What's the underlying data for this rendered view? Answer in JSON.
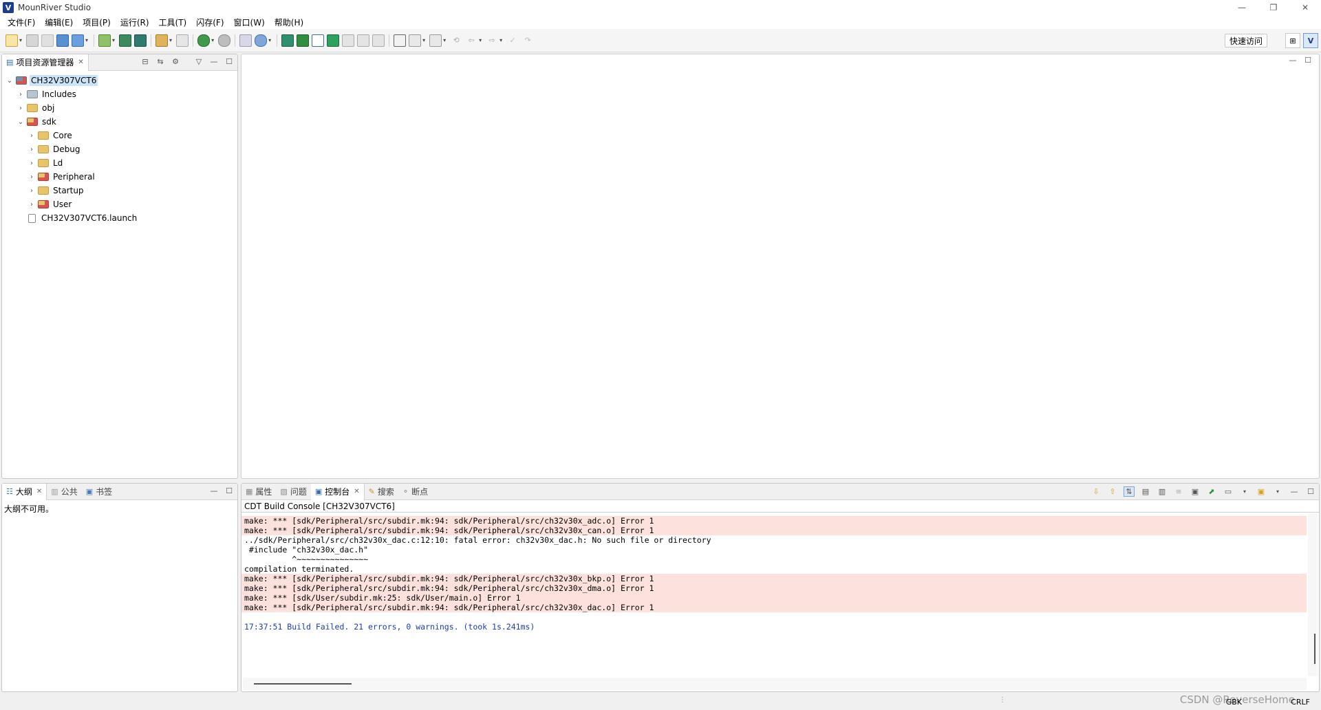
{
  "window": {
    "title": "MounRiver Studio",
    "logo": "V",
    "controls": [
      "—",
      "❐",
      "✕"
    ]
  },
  "menu": [
    "文件(F)",
    "编辑(E)",
    "项目(P)",
    "运行(R)",
    "工具(T)",
    "闪存(F)",
    "窗口(W)",
    "帮助(H)"
  ],
  "toolbar": {
    "quick_access_label": "快速访问"
  },
  "explorer": {
    "tab_label": "项目资源管理器",
    "items": [
      {
        "label": "CH32V307VCT6",
        "depth": 0,
        "twisty": "⌄",
        "icon": "project"
      },
      {
        "label": "Includes",
        "depth": 1,
        "twisty": "›",
        "icon": "includes"
      },
      {
        "label": "obj",
        "depth": 1,
        "twisty": "›",
        "icon": "folder"
      },
      {
        "label": "sdk",
        "depth": 1,
        "twisty": "⌄",
        "icon": "folder-red"
      },
      {
        "label": "Core",
        "depth": 2,
        "twisty": "›",
        "icon": "folder"
      },
      {
        "label": "Debug",
        "depth": 2,
        "twisty": "›",
        "icon": "folder"
      },
      {
        "label": "Ld",
        "depth": 2,
        "twisty": "›",
        "icon": "folder"
      },
      {
        "label": "Peripheral",
        "depth": 2,
        "twisty": "›",
        "icon": "folder-red"
      },
      {
        "label": "Startup",
        "depth": 2,
        "twisty": "›",
        "icon": "folder"
      },
      {
        "label": "User",
        "depth": 2,
        "twisty": "›",
        "icon": "folder-red"
      },
      {
        "label": "CH32V307VCT6.launch",
        "depth": 1,
        "twisty": "",
        "icon": "file"
      }
    ]
  },
  "outline": {
    "tabs": [
      "大纲",
      "公共",
      "书签"
    ],
    "message": "大纲不可用。"
  },
  "console": {
    "tabs": [
      "属性",
      "问题",
      "控制台",
      "搜索",
      "断点"
    ],
    "active_tab": "控制台",
    "title": "CDT Build Console [CH32V307VCT6]",
    "lines": [
      {
        "text": "make: *** [sdk/Peripheral/src/subdir.mk:94: sdk/Peripheral/src/ch32v30x_adc.o] Error 1",
        "kind": "err"
      },
      {
        "text": "make: *** [sdk/Peripheral/src/subdir.mk:94: sdk/Peripheral/src/ch32v30x_can.o] Error 1",
        "kind": "err"
      },
      {
        "text": "../sdk/Peripheral/src/ch32v30x_dac.c:12:10: fatal error: ch32v30x_dac.h: No such file or directory",
        "kind": "plain"
      },
      {
        "text": " #include \"ch32v30x_dac.h\"",
        "kind": "plain"
      },
      {
        "text": "          ^~~~~~~~~~~~~~~~",
        "kind": "plain"
      },
      {
        "text": "compilation terminated.",
        "kind": "plain"
      },
      {
        "text": "make: *** [sdk/Peripheral/src/subdir.mk:94: sdk/Peripheral/src/ch32v30x_bkp.o] Error 1",
        "kind": "err"
      },
      {
        "text": "make: *** [sdk/Peripheral/src/subdir.mk:94: sdk/Peripheral/src/ch32v30x_dma.o] Error 1",
        "kind": "err"
      },
      {
        "text": "make: *** [sdk/User/subdir.mk:25: sdk/User/main.o] Error 1",
        "kind": "err"
      },
      {
        "text": "make: *** [sdk/Peripheral/src/subdir.mk:94: sdk/Peripheral/src/ch32v30x_dac.o] Error 1",
        "kind": "err"
      },
      {
        "text": "",
        "kind": "plain"
      },
      {
        "text": "17:37:51 Build Failed. 21 errors, 0 warnings. (took 1s.241ms)",
        "kind": "info"
      }
    ]
  },
  "status": {
    "encoding": "GBK",
    "line_ending": "CRLF",
    "watermark": "CSDN @ReverseHome"
  },
  "colors": {
    "error_bg": "#fce1dc",
    "info_text": "#1a3bb6",
    "selection": "#cce4f7"
  }
}
